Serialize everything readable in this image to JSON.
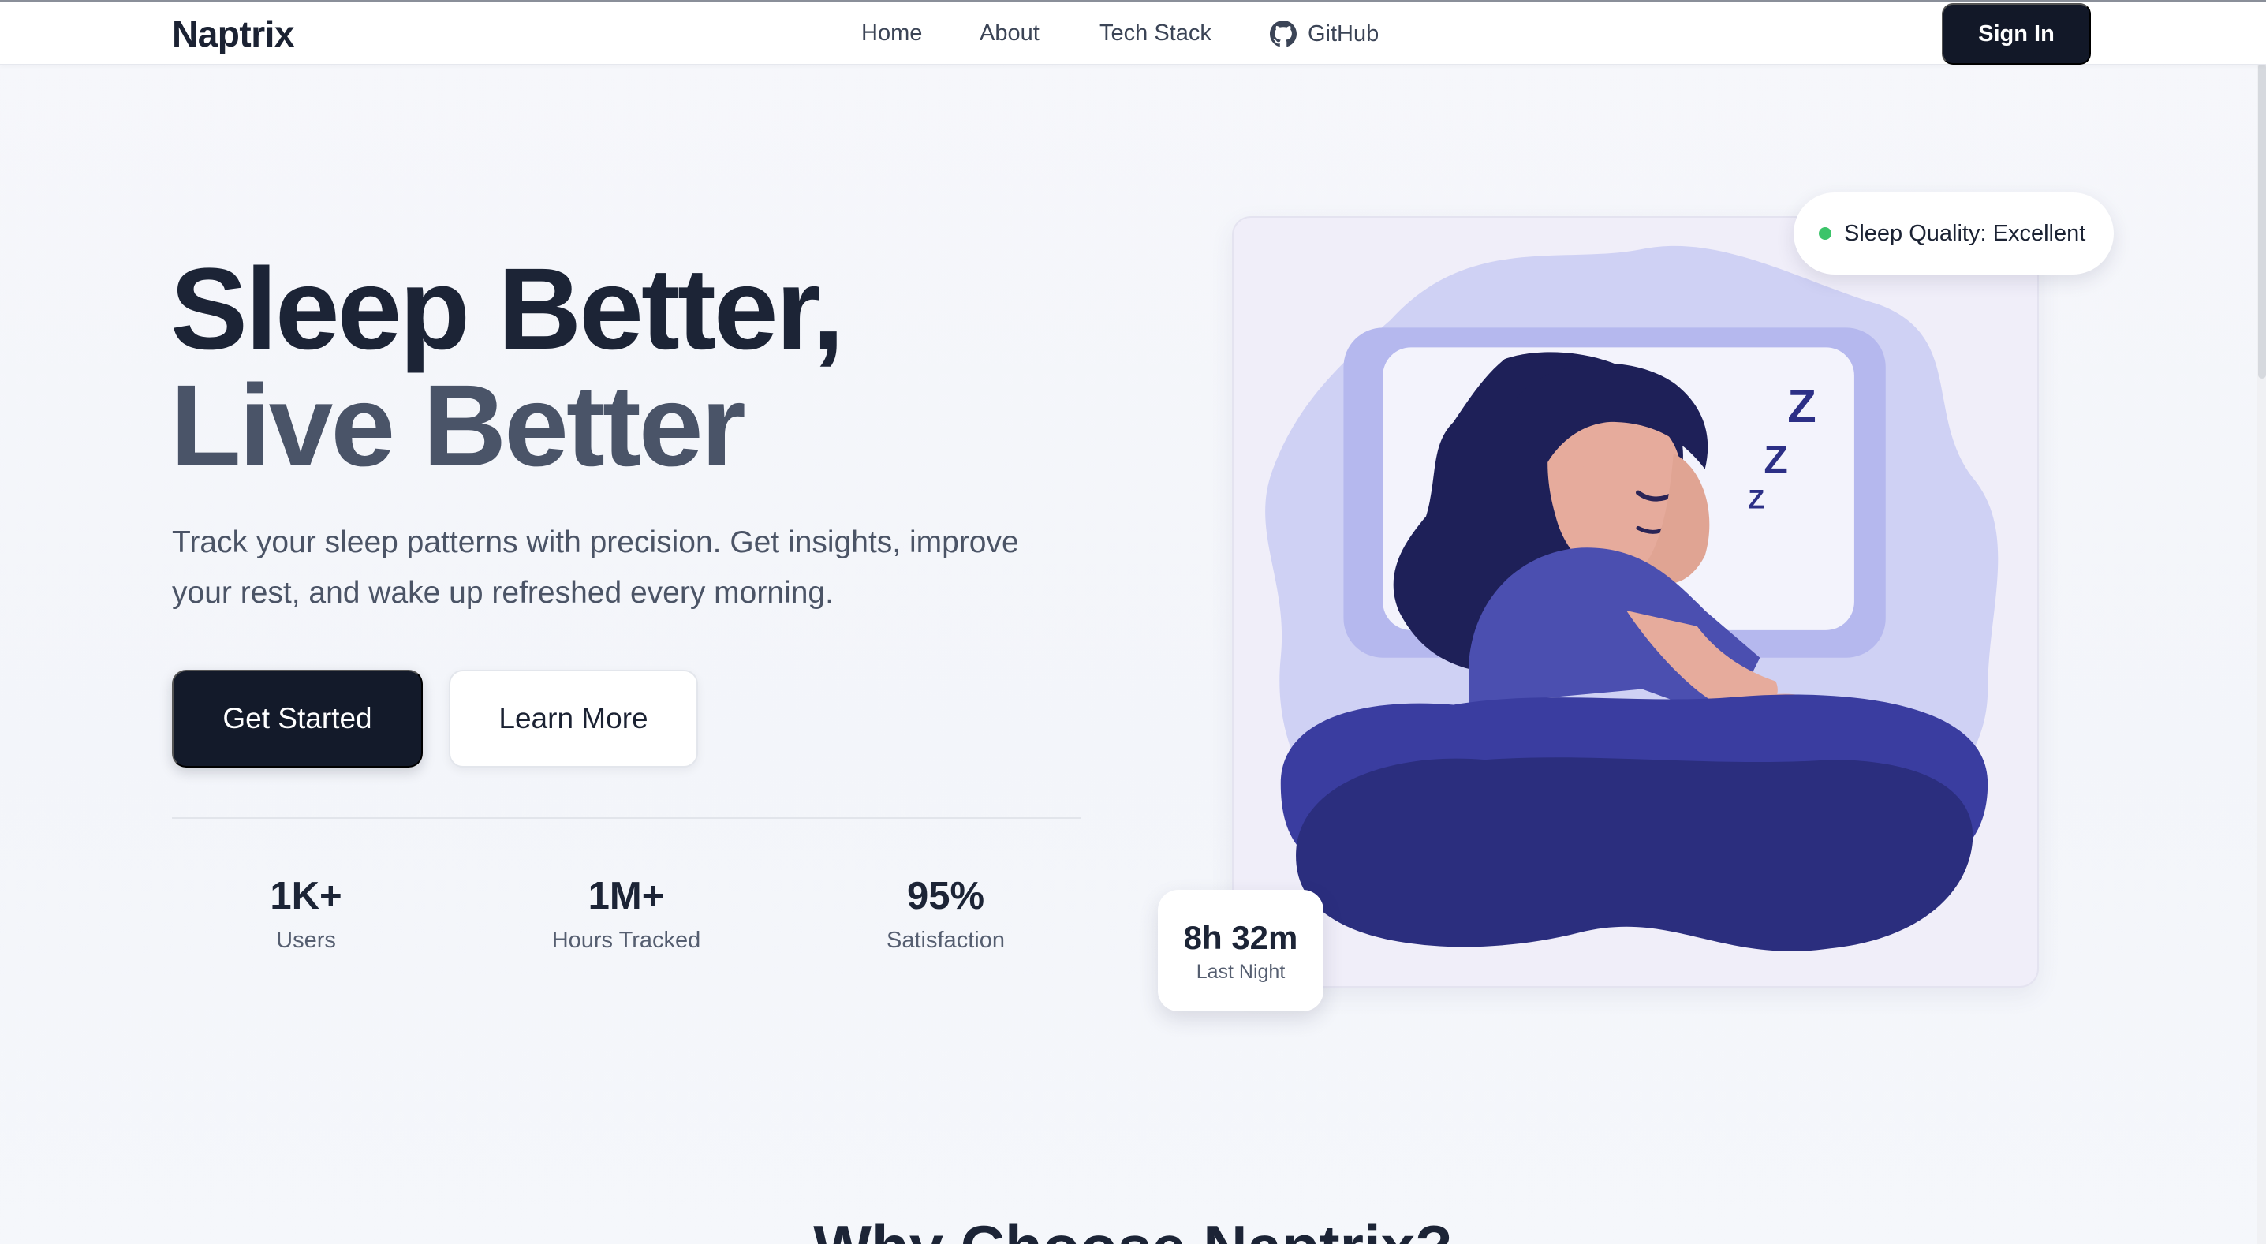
{
  "nav": {
    "logo": "Naptrix",
    "links": [
      "Home",
      "About",
      "Tech Stack",
      "GitHub"
    ],
    "signin": "Sign In"
  },
  "hero": {
    "title_line1": "Sleep Better,",
    "title_line2": "Live Better",
    "subtitle": "Track your sleep patterns with precision. Get insights, improve your rest, and wake up refreshed every morning.",
    "cta_primary": "Get Started",
    "cta_secondary": "Learn More"
  },
  "stats": [
    {
      "value": "1K+",
      "label": "Users"
    },
    {
      "value": "1M+",
      "label": "Hours Tracked"
    },
    {
      "value": "95%",
      "label": "Satisfaction"
    }
  ],
  "badges": {
    "quality": "Sleep Quality: Excellent",
    "sleep_time": "8h 32m",
    "sleep_label": "Last Night"
  },
  "section": {
    "why_title": "Why Choose Naptrix?"
  },
  "icons": {
    "github": "github-icon",
    "status": "green-dot-icon"
  },
  "colors": {
    "primary": "#131a2a",
    "accent_purple": "#3b3f9a",
    "status_green": "#3cc46a"
  }
}
